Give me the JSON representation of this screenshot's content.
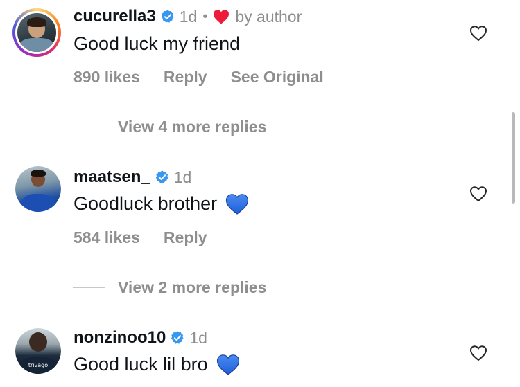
{
  "comments": [
    {
      "username": "cucurella3",
      "time": "1d",
      "separator": "•",
      "liked_by_author_text": "by author",
      "text": "Good luck my friend",
      "likes": "890 likes",
      "reply": "Reply",
      "see_original": "See Original",
      "view_more": "View 4 more replies"
    },
    {
      "username": "maatsen_",
      "time": "1d",
      "text": "Goodluck brother",
      "likes": "584 likes",
      "reply": "Reply",
      "view_more": "View 2 more replies"
    },
    {
      "username": "nonzinoo10",
      "time": "1d",
      "text": "Good luck lil bro",
      "shirt_text": "trivago"
    }
  ],
  "icons": {
    "verified": "verified-badge-icon",
    "heart_outline": "heart-outline-icon",
    "heart_red": "red-heart-icon",
    "heart_blue": "blue-heart-emoji"
  },
  "colors": {
    "verified_blue": "#3897f0",
    "heart_red": "#ed1c3a",
    "heart_blue": "#2f6fe0",
    "muted": "#8e8e8e"
  }
}
